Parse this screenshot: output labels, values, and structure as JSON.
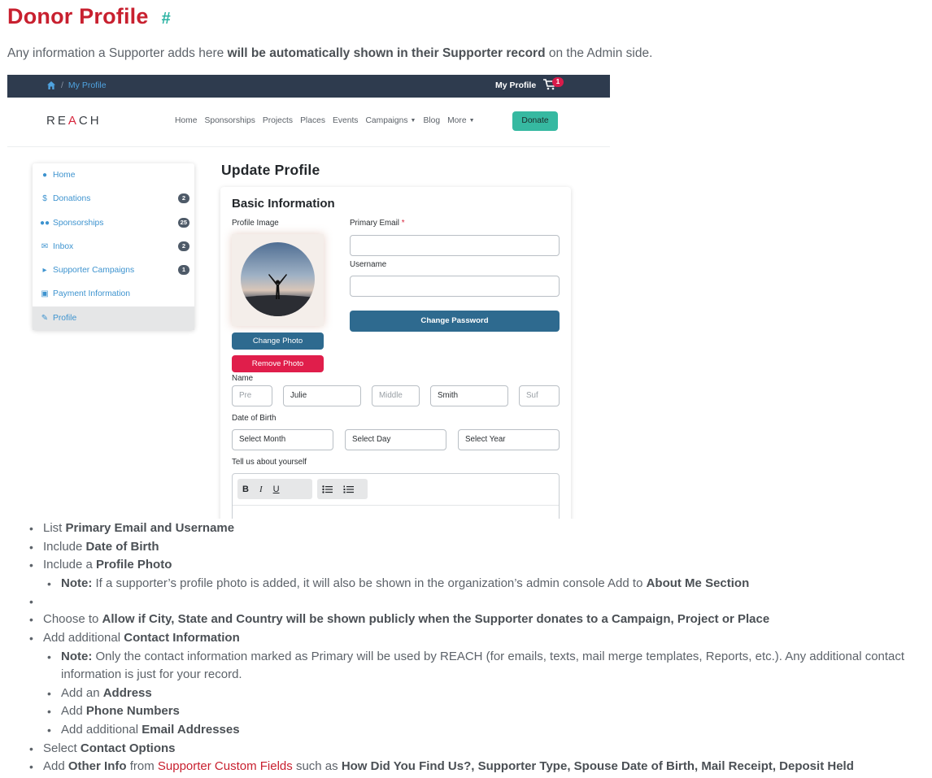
{
  "page": {
    "title": "Donor Profile",
    "anchor": "#",
    "intro_pre": "Any information a Supporter adds here ",
    "intro_bold": "will be automatically shown in their Supporter record",
    "intro_post": " on the Admin side."
  },
  "screenshot": {
    "topbar": {
      "breadcrumb_current": "My Profile",
      "breadcrumb_sep": "/",
      "account_label": "My Profile",
      "cart_count": "1"
    },
    "navbar": {
      "logo_pre": "RE",
      "logo_accent": "A",
      "logo_post": "CH",
      "links": [
        "Home",
        "Sponsorships",
        "Projects",
        "Places",
        "Events",
        "Campaigns",
        "Blog",
        "More"
      ],
      "donate_label": "Donate"
    },
    "sidebar": [
      {
        "label": "Home",
        "icon": "user-icon",
        "badge": ""
      },
      {
        "label": "Donations",
        "icon": "dollar-icon",
        "badge": "2"
      },
      {
        "label": "Sponsorships",
        "icon": "users-icon",
        "badge": "25"
      },
      {
        "label": "Inbox",
        "icon": "envelope-icon",
        "badge": "2"
      },
      {
        "label": "Supporter Campaigns",
        "icon": "bullhorn-icon",
        "badge": "1"
      },
      {
        "label": "Payment Information",
        "icon": "credit-card-icon",
        "badge": ""
      },
      {
        "label": "Profile",
        "icon": "pencil-icon",
        "badge": ""
      }
    ],
    "update_title": "Update Profile",
    "card": {
      "title": "Basic Information",
      "profile_image_label": "Profile Image",
      "primary_email_label": "Primary Email",
      "required_mark": "*",
      "username_label": "Username",
      "change_password": "Change Password",
      "change_photo": "Change Photo",
      "remove_photo": "Remove Photo",
      "name_label": "Name",
      "name_fields": {
        "prefix_placeholder": "Pre",
        "first": "Julie",
        "middle_placeholder": "Middle",
        "last": "Smith",
        "suffix_placeholder": "Suf"
      },
      "dob_label": "Date of Birth",
      "dob_fields": [
        "Select Month",
        "Select Day",
        "Select Year"
      ],
      "about_label": "Tell us about yourself",
      "toolbar": [
        "B",
        "I",
        "U"
      ]
    }
  },
  "bullets": {
    "b1_pre": "List ",
    "b1_bold": "Primary Email and Username",
    "b2_pre": "Include ",
    "b2_bold": "Date of Birth",
    "b3_pre": "Include a ",
    "b3_bold": "Profile Photo",
    "note1_bold": "Note:",
    "note1_text": " If a supporter’s profile photo is added, it will also be shown in the organization’s admin console Add to ",
    "note1_bold2": "About Me Section",
    "b4_pre": "Choose to ",
    "b4_bold": "Allow if City, State and Country will be shown publicly when the Supporter donates to a Campaign, Project or Place",
    "b5_pre": "Add additional ",
    "b5_bold": "Contact Information",
    "note2_bold": "Note:",
    "note2_text": " Only the contact information marked as Primary will be used by REACH (for emails, texts, mail merge templates, Reports, etc.). Any additional contact information is just for your record.",
    "s1_pre": "Add an ",
    "s1_bold": "Address",
    "s2_pre": "Add ",
    "s2_bold": "Phone Numbers",
    "s3_pre": "Add additional ",
    "s3_bold": "Email Addresses",
    "b6_pre": "Select ",
    "b6_bold": "Contact Options",
    "b7_pre": "Add ",
    "b7_bold": "Other Info",
    "b7_mid": " from ",
    "b7_link": "Supporter Custom Fields",
    "b7_mid2": " such as ",
    "b7_bold2": "How Did You Find Us?, Supporter Type, Spouse Date of Birth, Mail Receipt, Deposit Held"
  },
  "colors": {
    "title_red": "#c8202f",
    "anchor_teal": "#2bb3a3",
    "topbar": "#2e3b4e",
    "primary_btn": "#2e6a8f",
    "danger_btn": "#e01e4b",
    "donate": "#36b9a1"
  }
}
